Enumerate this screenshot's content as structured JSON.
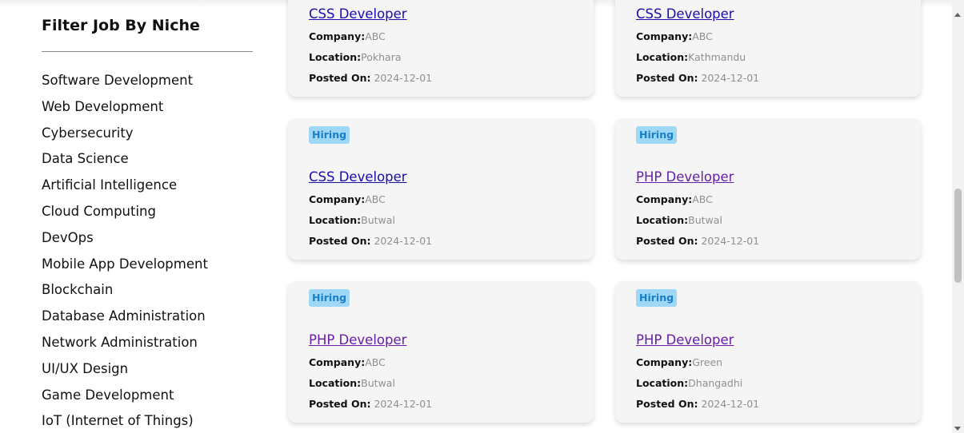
{
  "sidebar": {
    "title": "Filter Job By Niche",
    "niches": [
      "Software Development",
      "Web Development",
      "Cybersecurity",
      "Data Science",
      "Artificial Intelligence",
      "Cloud Computing",
      "DevOps",
      "Mobile App Development",
      "Blockchain",
      "Database Administration",
      "Network Administration",
      "UI/UX Design",
      "Game Development",
      "IoT (Internet of Things)"
    ]
  },
  "labels": {
    "company": "Company:",
    "location": "Location:",
    "posted": "Posted On:"
  },
  "colors": {
    "link": "#1a0dab",
    "visited_link": "#681da8",
    "badge_bg": "#9fd8f7",
    "badge_text": "#1a7fc9"
  },
  "jobs": [
    {
      "badge": "",
      "title": "CSS Developer",
      "visited": false,
      "company": "ABC",
      "location": "Pokhara",
      "posted": "2024-12-01"
    },
    {
      "badge": "",
      "title": "CSS Developer",
      "visited": false,
      "company": "ABC",
      "location": "Kathmandu",
      "posted": "2024-12-01"
    },
    {
      "badge": "Hiring",
      "title": "CSS Developer",
      "visited": false,
      "company": "ABC",
      "location": "Butwal",
      "posted": "2024-12-01"
    },
    {
      "badge": "Hiring",
      "title": "PHP Developer",
      "visited": true,
      "company": "ABC",
      "location": "Butwal",
      "posted": "2024-12-01"
    },
    {
      "badge": "Hiring",
      "title": "PHP Developer",
      "visited": true,
      "company": "ABC",
      "location": "Butwal",
      "posted": "2024-12-01"
    },
    {
      "badge": "Hiring",
      "title": "PHP Developer",
      "visited": true,
      "company": "Green",
      "location": "Dhangadhi",
      "posted": "2024-12-01"
    }
  ]
}
